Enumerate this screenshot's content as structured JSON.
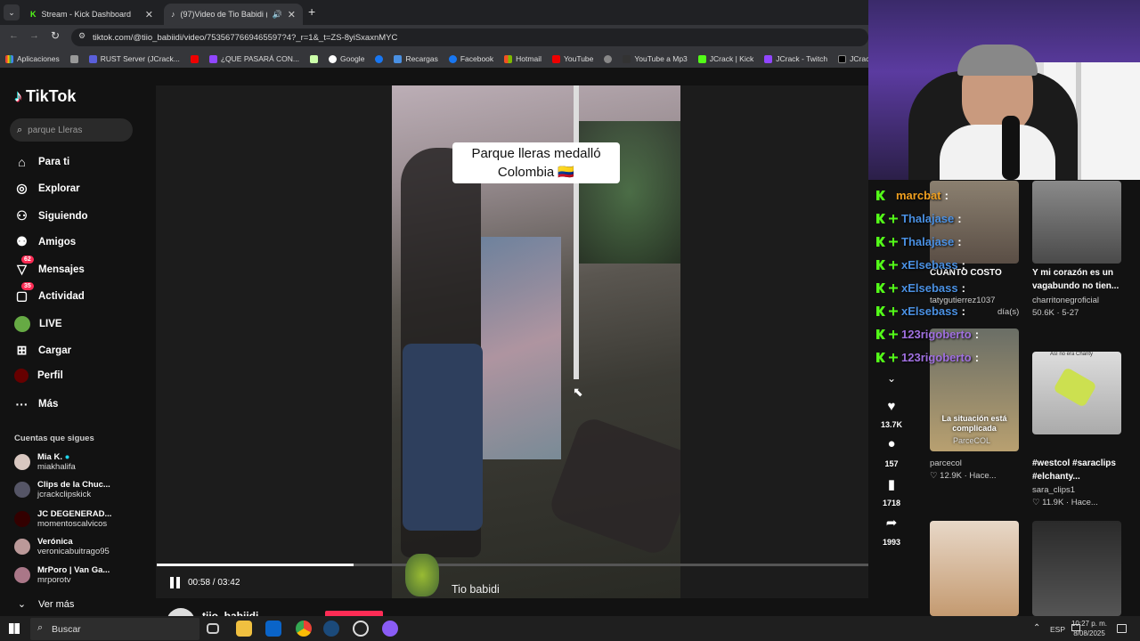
{
  "browser": {
    "tabs": [
      {
        "title": "Stream - Kick Dashboard"
      },
      {
        "title": "(97)Video de Tio Babidi (@"
      }
    ],
    "url": "tiktok.com/@tiio_babiidi/video/7535677669465597?4?_r=1&_t=ZS-8yiSxaxnMYC",
    "bookmarks": [
      "Aplicaciones",
      "RUST Server (JCrack...",
      "¿QUE PASARÁ CON...",
      "Google",
      "",
      "Recargas",
      "Facebook",
      "Hotmail",
      "YouTube",
      "",
      "YouTube a Mp3",
      "JCrack | Kick",
      "JCrack - Twitch",
      "JCrack (@JCra"
    ]
  },
  "tiktok": {
    "logo": "TikTok",
    "search_placeholder": "parque Lleras",
    "nav": [
      {
        "label": "Para ti",
        "icon": "home-icon"
      },
      {
        "label": "Explorar",
        "icon": "compass-icon"
      },
      {
        "label": "Siguiendo",
        "icon": "following-icon"
      },
      {
        "label": "Amigos",
        "icon": "friends-icon"
      },
      {
        "label": "Mensajes",
        "icon": "messages-icon",
        "badge": "62"
      },
      {
        "label": "Actividad",
        "icon": "activity-icon",
        "badge": "35"
      },
      {
        "label": "LIVE",
        "icon": "live-icon"
      },
      {
        "label": "Cargar",
        "icon": "upload-icon"
      },
      {
        "label": "Perfil",
        "icon": "profile-icon"
      },
      {
        "label": "Más",
        "icon": "more-icon"
      }
    ],
    "following_heading": "Cuentas que sigues",
    "following": [
      {
        "name": "Mia K.",
        "handle": "miakhalifa",
        "verified": true
      },
      {
        "name": "Clips de la Chuc...",
        "handle": "jcrackclipskick"
      },
      {
        "name": "JC DEGENERAD...",
        "handle": "momentoscalvicos"
      },
      {
        "name": "Verónica",
        "handle": "veronicabuitrago95"
      },
      {
        "name": "MrPoro | Van Ga...",
        "handle": "mrporotv"
      }
    ],
    "see_more": "Ver más",
    "video": {
      "overlay_line1": "Parque lleras medalló",
      "overlay_line2": "Colombia 🇨🇴",
      "time": "00:58 / 03:42",
      "progress": 0.26,
      "username": "Tio babidi",
      "author": "tiio_babiidi"
    },
    "actions": {
      "likes": "13.7K",
      "comments": "157",
      "saves": "1718",
      "shares": "1993"
    },
    "chat": [
      {
        "user": "marcbat",
        "color": "#f0a020",
        "badges": 1
      },
      {
        "user": "Thalajase",
        "color": "#4a90e2",
        "badges": 2
      },
      {
        "user": "Thalajase",
        "color": "#4a90e2",
        "badges": 2
      },
      {
        "user": "xElsebass",
        "color": "#4a90e2",
        "badges": 2
      },
      {
        "user": "xElsebass",
        "color": "#4a90e2",
        "badges": 2
      },
      {
        "user": "xElsebass",
        "color": "#4a90e2",
        "badges": 2
      },
      {
        "user": "123rigoberto",
        "color": "#a070e0",
        "badges": 2
      },
      {
        "user": "123rigoberto",
        "color": "#a070e0",
        "badges": 2
      }
    ],
    "related": [
      {
        "title": "CUANTO COSTO",
        "user": "tatygutierrez1037",
        "meta": "día(s)"
      },
      {
        "title": "Y mi corazón es un vagabundo no tien...",
        "user": "charritonegroficial",
        "meta": "50.6K · 5-27"
      },
      {
        "title": "La situación está complicada",
        "thumb_caption": "ParceCOL",
        "user": "parcecol",
        "meta": "12.9K · Hace..."
      },
      {
        "title": "#westcol #saraclips #elchanty...",
        "thumb_caption": "Así no era Chanty",
        "user": "sara_clips1",
        "meta": "11.9K · Hace..."
      }
    ]
  },
  "taskbar": {
    "search": "Buscar",
    "lang": "ESP",
    "time": "10:27 p. m.",
    "date": "8/08/2025"
  }
}
